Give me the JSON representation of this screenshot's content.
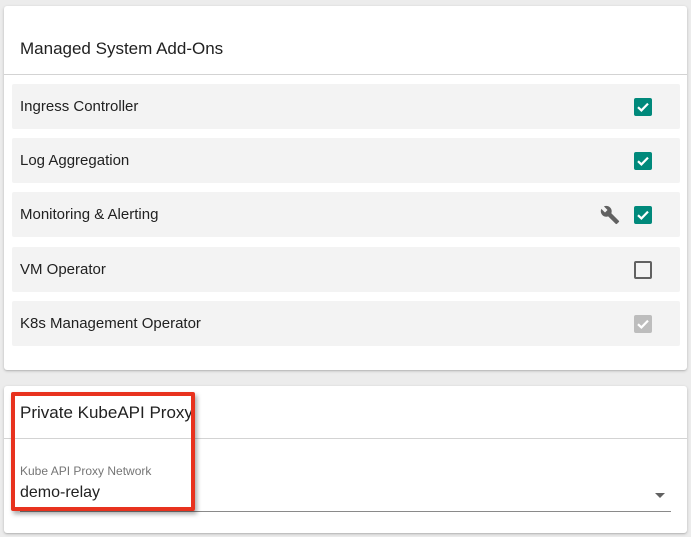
{
  "addons": {
    "title": "Managed System Add-Ons",
    "items": [
      {
        "label": "Ingress Controller",
        "state": "checked"
      },
      {
        "label": "Log Aggregation",
        "state": "checked"
      },
      {
        "label": "Monitoring & Alerting",
        "state": "checked",
        "wrench": true
      },
      {
        "label": "VM Operator",
        "state": "unchecked"
      },
      {
        "label": "K8s Management Operator",
        "state": "disabled"
      }
    ]
  },
  "proxy": {
    "title": "Private KubeAPI Proxy",
    "network_label": "Kube API Proxy Network",
    "network_value": "demo-relay"
  },
  "icons": {
    "configure": "wrench-icon",
    "dropdown": "chevron-down-icon"
  },
  "colors": {
    "accent": "#00897b",
    "disabled": "#bdbdbd",
    "highlight": "#e8321e"
  }
}
